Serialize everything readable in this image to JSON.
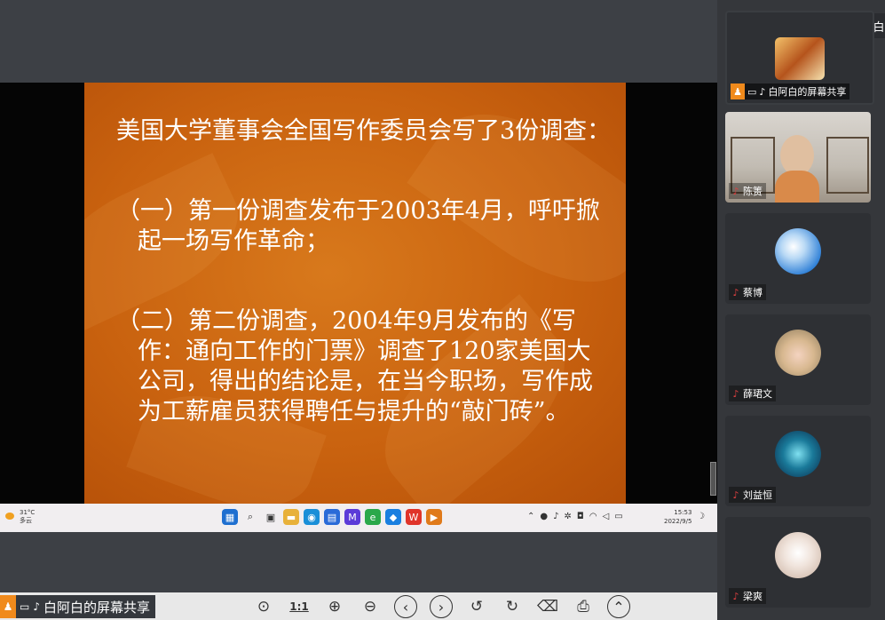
{
  "slide": {
    "lines": [
      "美国大学董事会全国写作委员会写了3份调查：",
      "（一）第一份调查发布于2003年4月，呼吁掀起一场写作革命；",
      "（二）第二份调查，2004年9月发布的《写作：通向工作的门票》调查了120家美国大公司，得出的结论是，在当今职场，写作成为工薪雇员获得聘任与提升的“敲门砖”。"
    ]
  },
  "taskbar": {
    "weather_temp": "31°C",
    "weather_desc": "多云",
    "time": "15:53",
    "date": "2022/9/5",
    "apps": [
      {
        "icon": "windows-start-icon",
        "glyph": "▦",
        "color": "#1f6fd0"
      },
      {
        "icon": "search-icon",
        "glyph": "⌕",
        "color": "#333333"
      },
      {
        "icon": "task-view-icon",
        "glyph": "▣",
        "color": "#333333"
      },
      {
        "icon": "file-explorer-icon",
        "glyph": "▬",
        "color": "#e8b13a"
      },
      {
        "icon": "edge-icon",
        "glyph": "◉",
        "color": "#1a8fd8"
      },
      {
        "icon": "store-icon",
        "glyph": "▤",
        "color": "#2a6bd8"
      },
      {
        "icon": "app-icon",
        "glyph": "M",
        "color": "#5b3bd8"
      },
      {
        "icon": "ie-icon",
        "glyph": "e",
        "color": "#2aa84a"
      },
      {
        "icon": "meeting-icon",
        "glyph": "◆",
        "color": "#1a7fe0"
      },
      {
        "icon": "wps-icon",
        "glyph": "W",
        "color": "#e0342a"
      },
      {
        "icon": "slideshow-icon",
        "glyph": "▶",
        "color": "#e07a1a"
      }
    ]
  },
  "bottombar": {
    "share_label": "白阿白的屏幕共享",
    "tools": [
      "1:1"
    ]
  },
  "speaking": {
    "label": "正在讲话: 白"
  },
  "participants": [
    {
      "name": "白阿白的屏幕共享",
      "active": true
    },
    {
      "name": "陈箦"
    },
    {
      "name": "蔡博"
    },
    {
      "name": "薛珺文"
    },
    {
      "name": "刘益恒"
    },
    {
      "name": "梁爽"
    }
  ]
}
